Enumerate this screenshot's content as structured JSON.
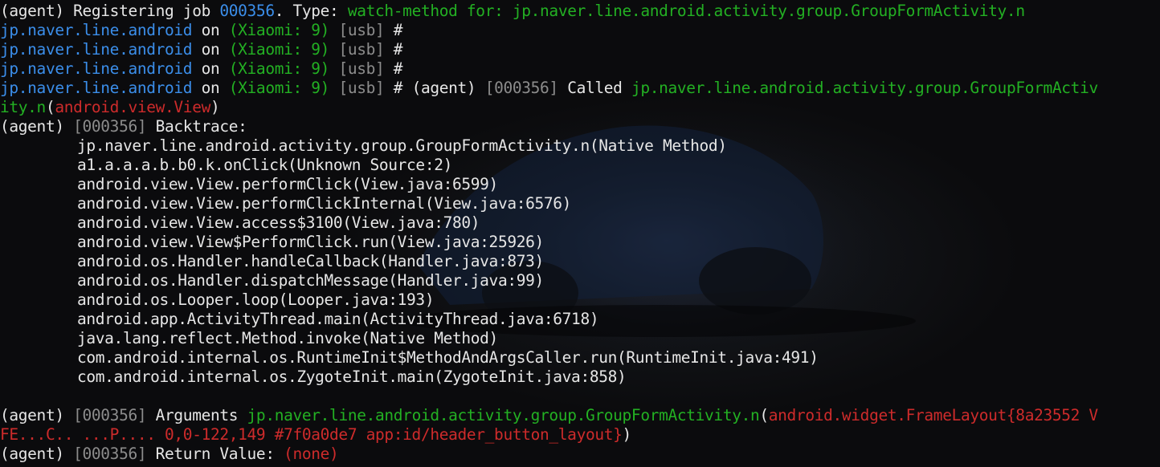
{
  "colors": {
    "text": "#e6e6e6",
    "package": "#3b8eea",
    "method": "#23b023",
    "muted": "#8c8c8c",
    "argument": "#cd2b2b",
    "background": "#0b0b0d"
  },
  "lines": [
    {
      "indent": false,
      "segs": [
        {
          "t": "(agent) Registering job ",
          "c": "white"
        },
        {
          "t": "000356",
          "c": "blue"
        },
        {
          "t": ". Type: ",
          "c": "white"
        },
        {
          "t": "watch-method for: jp.naver.line.android.activity.group.GroupFormActivity.n",
          "c": "green"
        }
      ]
    },
    {
      "indent": false,
      "segs": [
        {
          "t": "jp.naver.line.android",
          "c": "blue"
        },
        {
          "t": " on ",
          "c": "white"
        },
        {
          "t": "(Xiaomi: 9)",
          "c": "green"
        },
        {
          "t": " [usb]",
          "c": "gray"
        },
        {
          "t": " #",
          "c": "white"
        }
      ]
    },
    {
      "indent": false,
      "segs": [
        {
          "t": "jp.naver.line.android",
          "c": "blue"
        },
        {
          "t": " on ",
          "c": "white"
        },
        {
          "t": "(Xiaomi: 9)",
          "c": "green"
        },
        {
          "t": " [usb]",
          "c": "gray"
        },
        {
          "t": " #",
          "c": "white"
        }
      ]
    },
    {
      "indent": false,
      "segs": [
        {
          "t": "jp.naver.line.android",
          "c": "blue"
        },
        {
          "t": " on ",
          "c": "white"
        },
        {
          "t": "(Xiaomi: 9)",
          "c": "green"
        },
        {
          "t": " [usb]",
          "c": "gray"
        },
        {
          "t": " #",
          "c": "white"
        }
      ]
    },
    {
      "indent": false,
      "segs": [
        {
          "t": "jp.naver.line.android",
          "c": "blue"
        },
        {
          "t": " on ",
          "c": "white"
        },
        {
          "t": "(Xiaomi: 9)",
          "c": "green"
        },
        {
          "t": " [usb]",
          "c": "gray"
        },
        {
          "t": " # (agent) ",
          "c": "white"
        },
        {
          "t": "[000356]",
          "c": "gray"
        },
        {
          "t": " Called ",
          "c": "white"
        },
        {
          "t": "jp.naver.line.android.activity.group.GroupFormActiv",
          "c": "green"
        }
      ]
    },
    {
      "indent": false,
      "segs": [
        {
          "t": "ity.n",
          "c": "green"
        },
        {
          "t": "(",
          "c": "white"
        },
        {
          "t": "android.view.View",
          "c": "red"
        },
        {
          "t": ")",
          "c": "white"
        }
      ]
    },
    {
      "indent": false,
      "segs": [
        {
          "t": "(agent) ",
          "c": "white"
        },
        {
          "t": "[000356]",
          "c": "gray"
        },
        {
          "t": " Backtrace:",
          "c": "white"
        }
      ]
    },
    {
      "indent": true,
      "segs": [
        {
          "t": "jp.naver.line.android.activity.group.GroupFormActivity.n(Native Method)",
          "c": "white"
        }
      ]
    },
    {
      "indent": true,
      "segs": [
        {
          "t": "a1.a.a.a.b.b0.k.onClick(Unknown Source:2)",
          "c": "white"
        }
      ]
    },
    {
      "indent": true,
      "segs": [
        {
          "t": "android.view.View.performClick(View.java:6599)",
          "c": "white"
        }
      ]
    },
    {
      "indent": true,
      "segs": [
        {
          "t": "android.view.View.performClickInternal(View.java:6576)",
          "c": "white"
        }
      ]
    },
    {
      "indent": true,
      "segs": [
        {
          "t": "android.view.View.access$3100(View.java:780)",
          "c": "white"
        }
      ]
    },
    {
      "indent": true,
      "segs": [
        {
          "t": "android.view.View$PerformClick.run(View.java:25926)",
          "c": "white"
        }
      ]
    },
    {
      "indent": true,
      "segs": [
        {
          "t": "android.os.Handler.handleCallback(Handler.java:873)",
          "c": "white"
        }
      ]
    },
    {
      "indent": true,
      "segs": [
        {
          "t": "android.os.Handler.dispatchMessage(Handler.java:99)",
          "c": "white"
        }
      ]
    },
    {
      "indent": true,
      "segs": [
        {
          "t": "android.os.Looper.loop(Looper.java:193)",
          "c": "white"
        }
      ]
    },
    {
      "indent": true,
      "segs": [
        {
          "t": "android.app.ActivityThread.main(ActivityThread.java:6718)",
          "c": "white"
        }
      ]
    },
    {
      "indent": true,
      "segs": [
        {
          "t": "java.lang.reflect.Method.invoke(Native Method)",
          "c": "white"
        }
      ]
    },
    {
      "indent": true,
      "segs": [
        {
          "t": "com.android.internal.os.RuntimeInit$MethodAndArgsCaller.run(RuntimeInit.java:491)",
          "c": "white"
        }
      ]
    },
    {
      "indent": true,
      "segs": [
        {
          "t": "com.android.internal.os.ZygoteInit.main(ZygoteInit.java:858)",
          "c": "white"
        }
      ]
    },
    {
      "indent": false,
      "segs": []
    },
    {
      "indent": false,
      "segs": [
        {
          "t": "(agent) ",
          "c": "white"
        },
        {
          "t": "[000356]",
          "c": "gray"
        },
        {
          "t": " Arguments ",
          "c": "white"
        },
        {
          "t": "jp.naver.line.android.activity.group.GroupFormActivity.n",
          "c": "green"
        },
        {
          "t": "(",
          "c": "white"
        },
        {
          "t": "android.widget.FrameLayout{8a23552 V",
          "c": "red"
        }
      ]
    },
    {
      "indent": false,
      "segs": [
        {
          "t": "FE...C.. ...P.... 0,0-122,149 #7f0a0de7 app:id/header_button_layout}",
          "c": "red"
        },
        {
          "t": ")",
          "c": "white"
        }
      ]
    },
    {
      "indent": false,
      "segs": [
        {
          "t": "(agent) ",
          "c": "white"
        },
        {
          "t": "[000356]",
          "c": "gray"
        },
        {
          "t": " Return Value: ",
          "c": "white"
        },
        {
          "t": "(none)",
          "c": "red"
        }
      ]
    }
  ]
}
